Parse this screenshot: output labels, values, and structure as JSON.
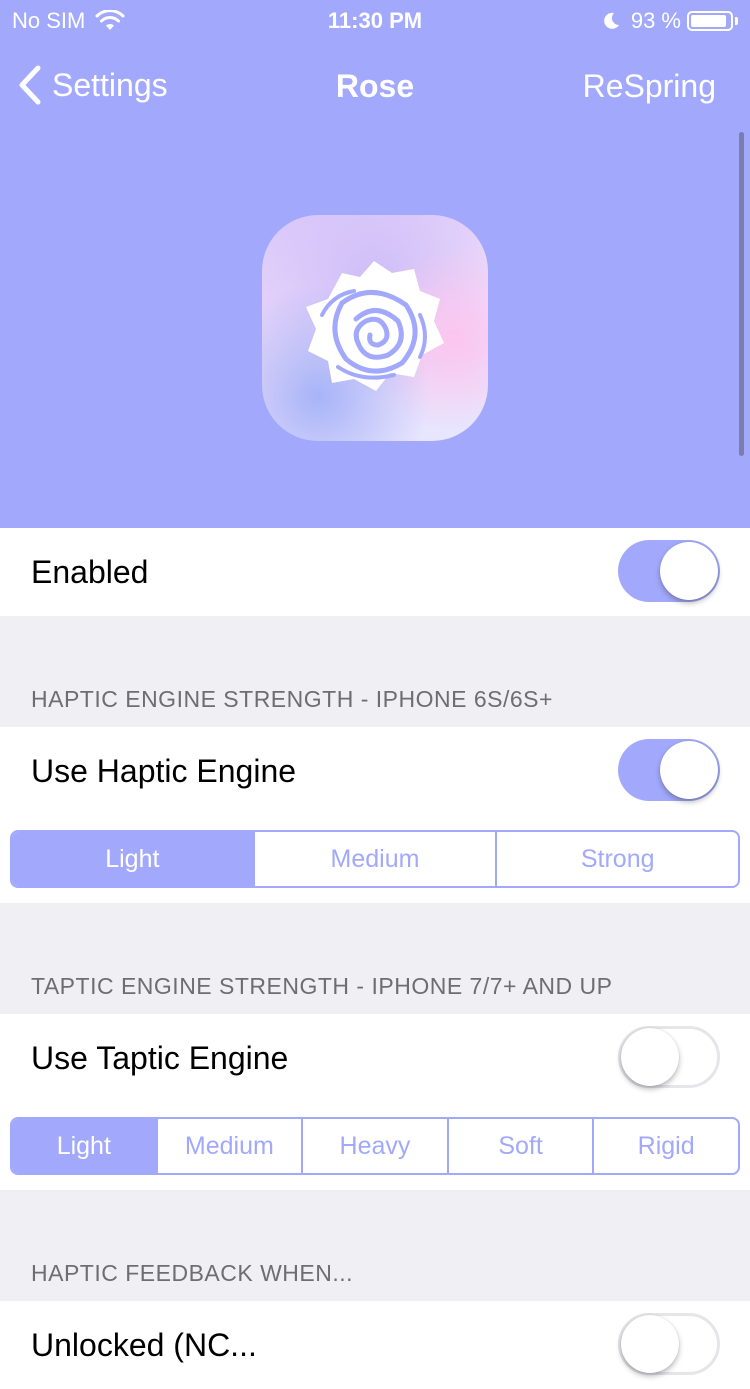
{
  "status_bar": {
    "carrier": "No SIM",
    "time": "11:30 PM",
    "battery_percent": "93 %",
    "battery_level": 0.93
  },
  "nav": {
    "back_label": "Settings",
    "title": "Rose",
    "action_label": "ReSpring"
  },
  "colors": {
    "accent": "#a2a9fc",
    "grouped_background": "#efeff4",
    "section_header_text": "#6d6d72"
  },
  "enabled_row": {
    "label": "Enabled",
    "on": true
  },
  "haptic_section": {
    "header": "HAPTIC ENGINE STRENGTH - IPHONE 6S/6S+",
    "toggle_label": "Use Haptic Engine",
    "toggle_on": true,
    "segments": [
      "Light",
      "Medium",
      "Strong"
    ],
    "selected": "Light"
  },
  "taptic_section": {
    "header": "TAPTIC ENGINE STRENGTH - IPHONE 7/7+ AND UP",
    "toggle_label": "Use Taptic Engine",
    "toggle_on": false,
    "segments": [
      "Light",
      "Medium",
      "Heavy",
      "Soft",
      "Rigid"
    ],
    "selected": "Light"
  },
  "feedback_section": {
    "header": "HAPTIC FEEDBACK WHEN...",
    "first_row_label": "Unlocked (NC..."
  }
}
